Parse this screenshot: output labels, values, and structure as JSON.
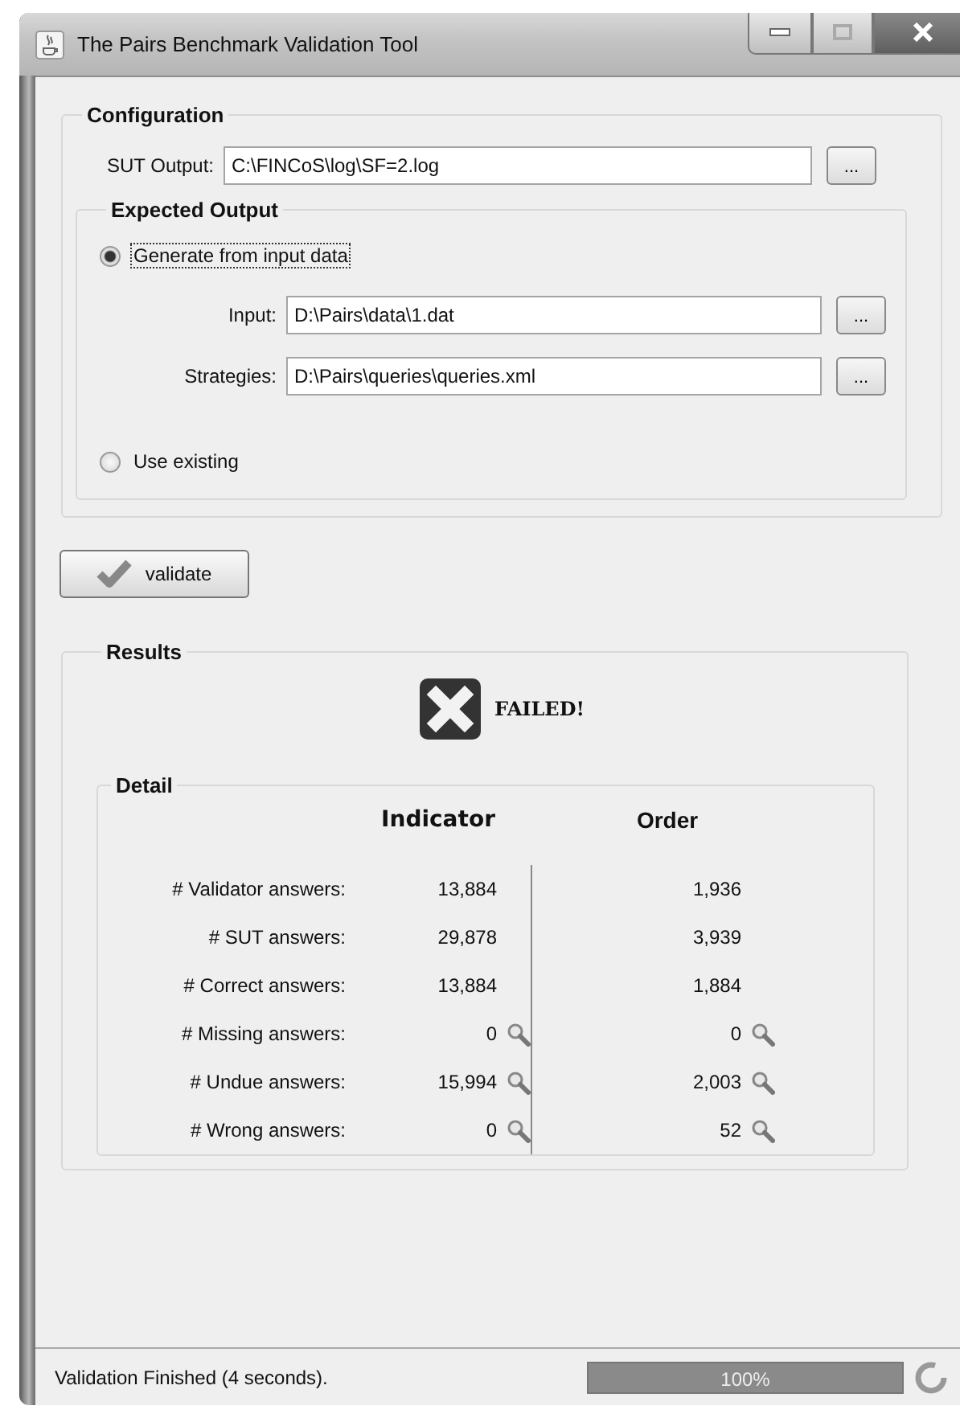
{
  "window": {
    "title": "The Pairs Benchmark Validation Tool"
  },
  "configuration": {
    "legend": "Configuration",
    "sut_output": {
      "label": "SUT Output:",
      "value": "C:\\FINCoS\\log\\SF=2.log",
      "browse": "..."
    },
    "expected_output": {
      "legend": "Expected Output",
      "generate": {
        "label": "Generate from input data",
        "selected": true,
        "focused": true
      },
      "fields": [
        {
          "label": "Input:",
          "value": "D:\\Pairs\\data\\1.dat",
          "browse": "..."
        },
        {
          "label": "Strategies:",
          "value": "D:\\Pairs\\queries\\queries.xml",
          "browse": "..."
        }
      ],
      "use_existing": {
        "label": "Use existing",
        "selected": false
      }
    }
  },
  "validate_button": "validate",
  "results": {
    "legend": "Results",
    "status": {
      "kind": "failed",
      "text": "FAILED!"
    },
    "detail": {
      "legend": "Detail",
      "columns": [
        "Indicator",
        "Order"
      ],
      "rows": [
        {
          "label": "# Validator answers:",
          "values": [
            {
              "text": "13,884",
              "inspect": false
            },
            {
              "text": "1,936",
              "inspect": false
            }
          ]
        },
        {
          "label": "# SUT answers:",
          "values": [
            {
              "text": "29,878",
              "inspect": false
            },
            {
              "text": "3,939",
              "inspect": false
            }
          ]
        },
        {
          "label": "# Correct answers:",
          "values": [
            {
              "text": "13,884",
              "inspect": false
            },
            {
              "text": "1,884",
              "inspect": false
            }
          ]
        },
        {
          "label": "# Missing answers:",
          "values": [
            {
              "text": "0",
              "inspect": true
            },
            {
              "text": "0",
              "inspect": true
            }
          ]
        },
        {
          "label": "# Undue answers:",
          "values": [
            {
              "text": "15,994",
              "inspect": true
            },
            {
              "text": "2,003",
              "inspect": true
            }
          ]
        },
        {
          "label": "# Wrong answers:",
          "values": [
            {
              "text": "0",
              "inspect": true
            },
            {
              "text": "52",
              "inspect": true
            }
          ]
        }
      ]
    }
  },
  "status_bar": {
    "message": "Validation Finished (4 seconds).",
    "progress": {
      "level": 1,
      "text": "100%"
    }
  }
}
